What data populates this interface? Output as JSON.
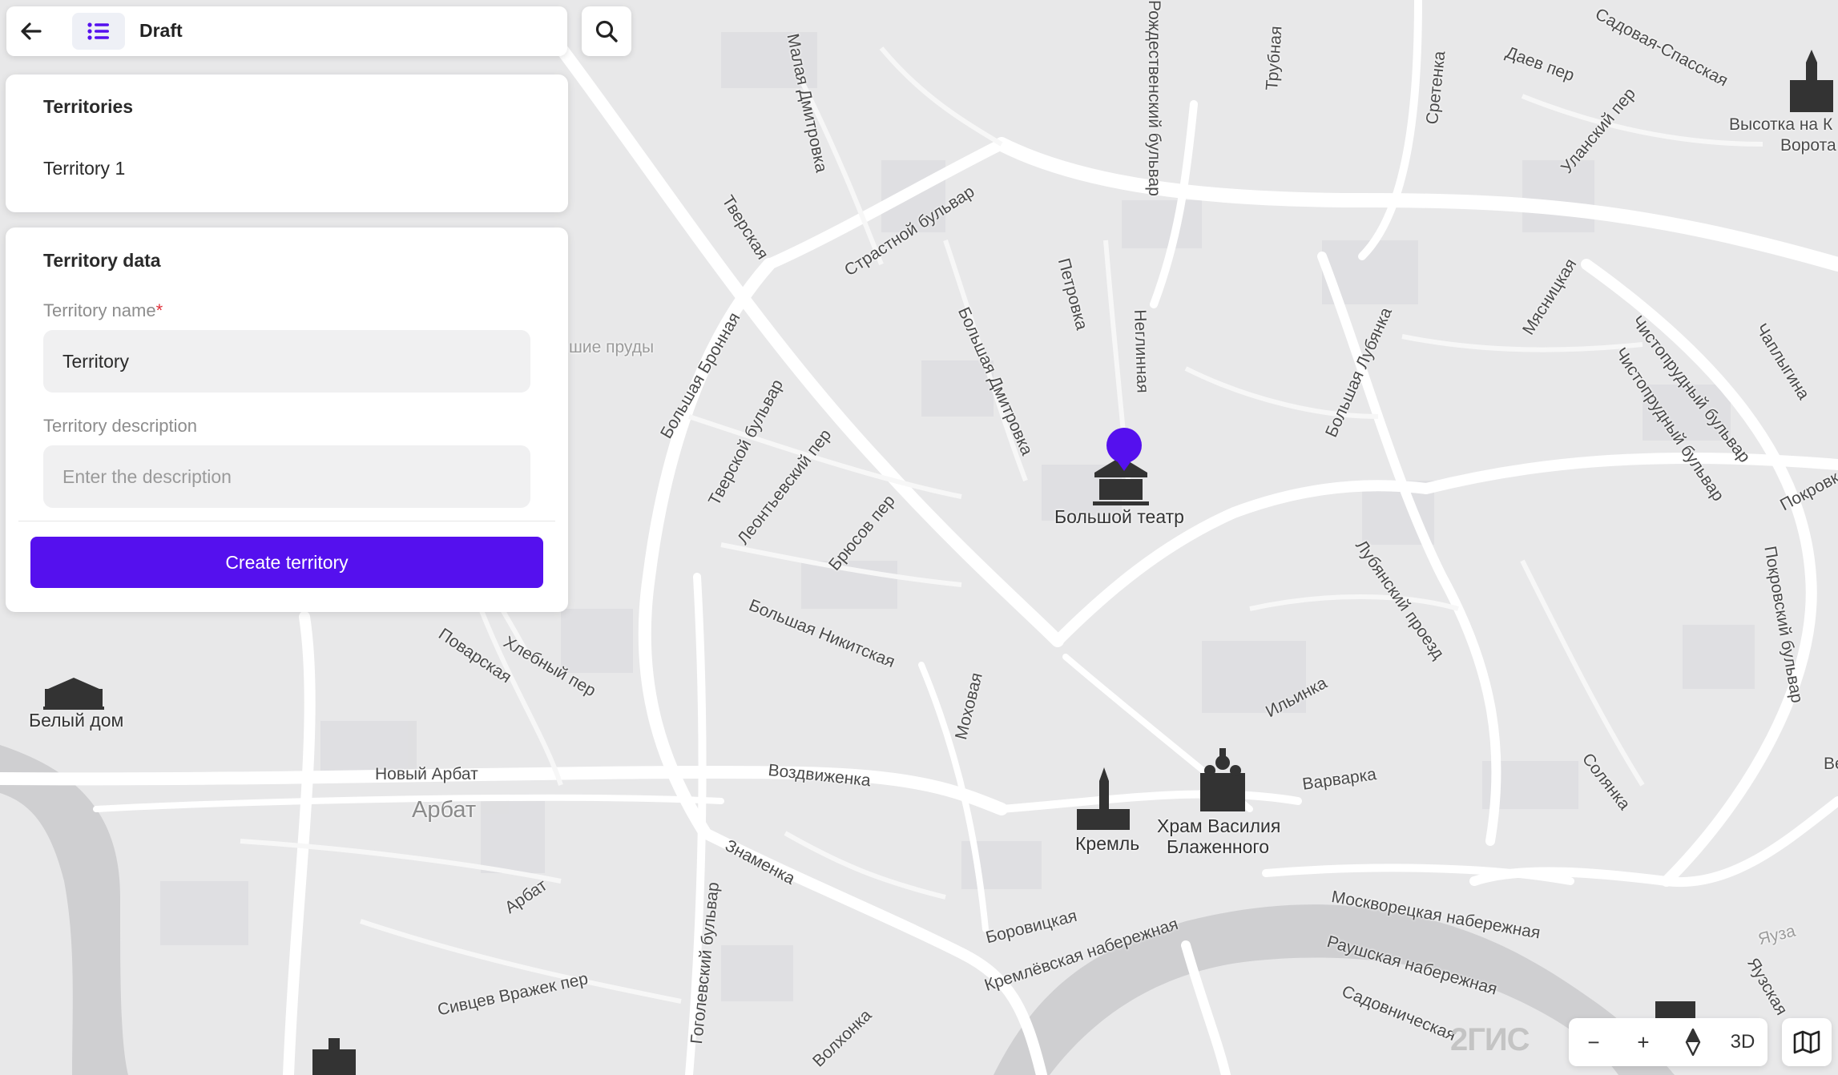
{
  "header": {
    "title": "Draft"
  },
  "territories_panel": {
    "title": "Territories",
    "items": [
      "Territory 1"
    ]
  },
  "form": {
    "title": "Territory data",
    "name_label": "Territory name",
    "required_mark": "*",
    "name_value": "Territory",
    "description_label": "Territory description",
    "description_placeholder": "Enter the description",
    "submit_label": "Create territory"
  },
  "map": {
    "provider_logo": "2ГИС",
    "controls": {
      "zoom_out": "−",
      "zoom_in": "+",
      "mode_3d": "3D"
    },
    "marker_color": "#5510ee",
    "labels": {
      "malaya_dmitrovka": "Малая Дмитровка",
      "tverskaya": "Тверская",
      "strastnoy": "Страстной бульвар",
      "petrovka": "Петровка",
      "neglinnaya": "Неглинная",
      "bolshaya_dmitrovka": "Большая Дмитровка",
      "bolshaya_bronnaya": "Большая Бронная",
      "tverskoy": "Тверской бульвар",
      "leontievsky": "Леонтьевский пер",
      "bryusov": "Брюсов пер",
      "bolshaya_nikitskaya": "Большая Никитская",
      "povarskaya": "Поварская",
      "khlebny": "Хлебный пер",
      "mokhovaya": "Моховая",
      "novy_arbat": "Новый Арбат",
      "arbat_district": "Арбат",
      "vozdvizhenka": "Воздвиженка",
      "znamenka": "Знаменка",
      "arbat_street": "Арбат",
      "gogolevsky": "Гоголевский бульвар",
      "sivtsev": "Сивцев Вражек пер",
      "volkhonka": "Волхонка",
      "borovitskaya": "Боровицкая",
      "kremlevskaya_nab": "Кремлёвская набережная",
      "moskvoretskaya_nab": "Москворецкая набережная",
      "raushskaya_nab": "Раушская набережная",
      "sadovnicheskaya": "Садовническая",
      "ilyinka": "Ильинка",
      "varvarka": "Варварка",
      "lubyansky": "Лубянский проезд",
      "bolshaya_lubyanka": "Большая Лубянка",
      "myasnitskaya": "Мясницкая",
      "chistoprudny": "Чистопрудный бульвар",
      "chistoprudny2": "Чистопрудный бульвар",
      "chaplygina": "Чаплыгина",
      "pokrovsky": "Покровский бульвар",
      "pokrovka": "Покровка",
      "solyanka": "Солянка",
      "yauza": "Яуза",
      "yauzskaya": "Яузская",
      "sretenka": "Сретенка",
      "trubnaya": "Трубная",
      "rozhdestvensky": "Рождественский бульвар",
      "daev": "Даев пер",
      "ulansky": "Уланский пер",
      "sadovaya_spasskaya": "Садовая-Спасская",
      "ponds": "шие пруды",
      "vysotka": "Высотка на К",
      "vorota": "Ворота",
      "pokrovka_cut": "Покровк",
      "ve_cut": "Ве"
    },
    "pois": {
      "bolshoi": "Большой театр",
      "white_house": "Белый дом",
      "kremlin": "Кремль",
      "st_basil_line1": "Храм Василия",
      "st_basil_line2": "Блаженного"
    }
  }
}
